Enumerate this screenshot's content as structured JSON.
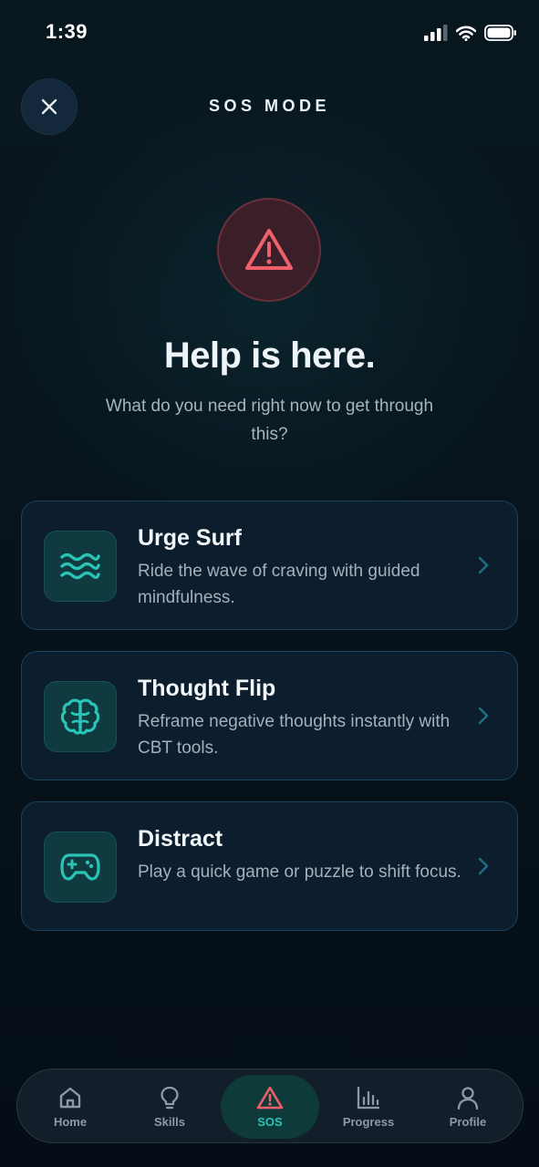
{
  "status_bar": {
    "time": "1:39"
  },
  "header": {
    "title": "SOS MODE"
  },
  "hero": {
    "title": "Help is here.",
    "subtitle": "What do you need right now to get through this?"
  },
  "cards": [
    {
      "title": "Urge Surf",
      "description": "Ride the wave of craving with guided mindfulness.",
      "icon": "waves-icon"
    },
    {
      "title": "Thought Flip",
      "description": "Reframe negative thoughts instantly with CBT tools.",
      "icon": "brain-icon"
    },
    {
      "title": "Distract",
      "description": "Play a quick game or puzzle to shift focus.",
      "icon": "gamepad-icon"
    }
  ],
  "nav": {
    "items": [
      {
        "label": "Home",
        "icon": "home-icon"
      },
      {
        "label": "Skills",
        "icon": "lightbulb-icon"
      },
      {
        "label": "SOS",
        "icon": "alert-triangle-icon",
        "active": true
      },
      {
        "label": "Progress",
        "icon": "bar-chart-icon"
      },
      {
        "label": "Profile",
        "icon": "user-icon"
      }
    ]
  },
  "colors": {
    "background": "#06121a",
    "accent_teal": "#2bc3b5",
    "alert_red": "#f0606a",
    "card_bg": "#0c1d2e",
    "card_border": "#17445a"
  }
}
